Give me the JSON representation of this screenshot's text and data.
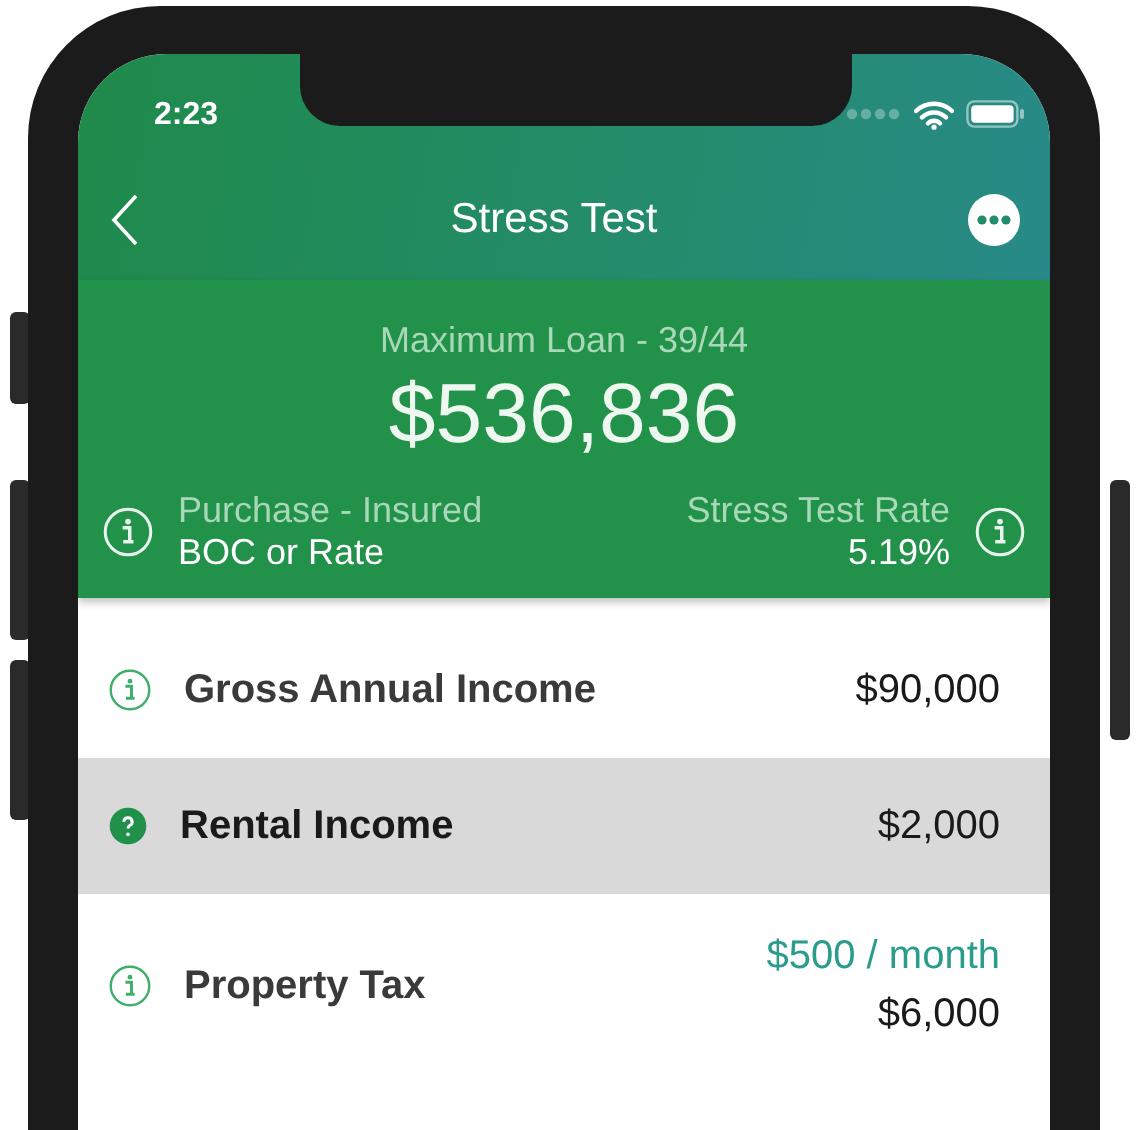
{
  "status_bar": {
    "time": "2:23"
  },
  "nav": {
    "title": "Stress Test"
  },
  "summary": {
    "caption": "Maximum Loan - 39/44",
    "amount": "$536,836",
    "left": {
      "label": "Purchase - Insured",
      "value": "BOC or Rate"
    },
    "right": {
      "label": "Stress Test Rate",
      "value": "5.19%"
    }
  },
  "rows": [
    {
      "kind": "info",
      "label": "Gross Annual Income",
      "value": "$90,000",
      "selected": false
    },
    {
      "kind": "help",
      "label": "Rental Income",
      "value": "$2,000",
      "selected": true
    },
    {
      "kind": "info",
      "label": "Property Tax",
      "monthly": "$500 / month",
      "value": "$6,000",
      "selected": false
    }
  ]
}
